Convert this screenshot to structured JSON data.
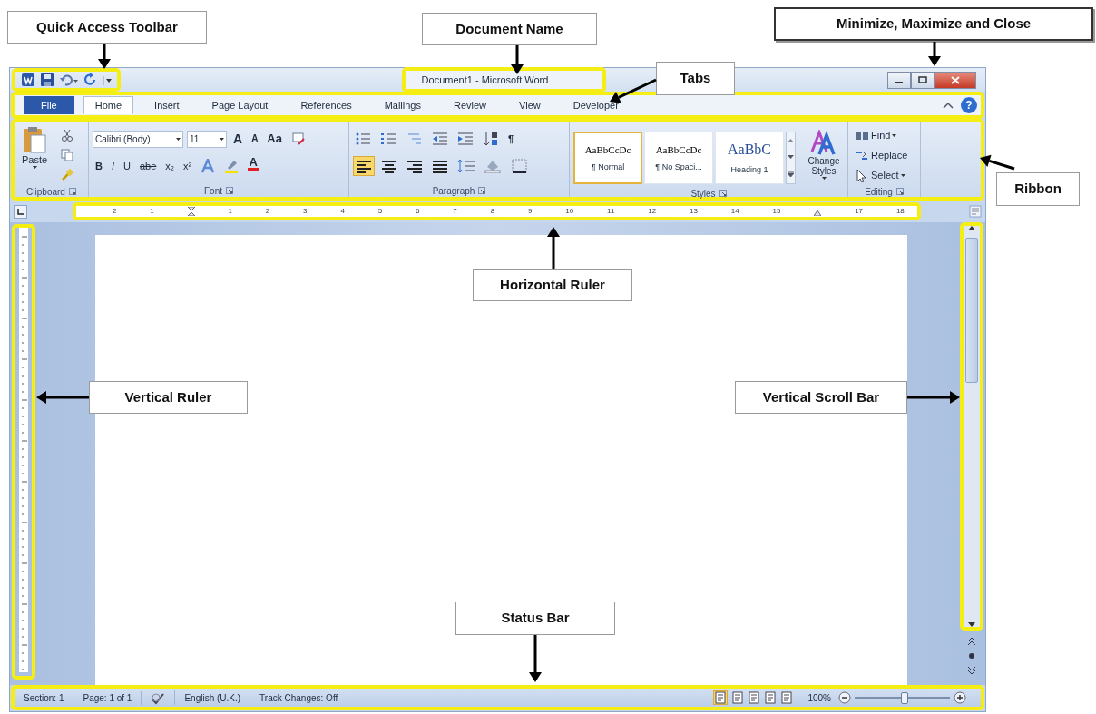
{
  "annotations": [
    {
      "text": "Quick Access Toolbar"
    },
    {
      "text": "Document Name"
    },
    {
      "text": "Minimize, Maximize and Close"
    },
    {
      "text": "Tabs"
    },
    {
      "text": "Ribbon"
    },
    {
      "text": "Horizontal Ruler"
    },
    {
      "text": "Vertical Ruler"
    },
    {
      "text": "Vertical Scroll Bar"
    },
    {
      "text": "Status Bar"
    }
  ],
  "window": {
    "title": "Document1 - Microsoft Word"
  },
  "tabs": [
    {
      "label": "File",
      "kind": "file",
      "selected": false
    },
    {
      "label": "Home",
      "kind": "tab",
      "selected": true
    },
    {
      "label": "Insert",
      "kind": "tab",
      "selected": false
    },
    {
      "label": "Page Layout",
      "kind": "tab",
      "selected": false
    },
    {
      "label": "References",
      "kind": "tab",
      "selected": false
    },
    {
      "label": "Mailings",
      "kind": "tab",
      "selected": false
    },
    {
      "label": "Review",
      "kind": "tab",
      "selected": false
    },
    {
      "label": "View",
      "kind": "tab",
      "selected": false
    },
    {
      "label": "Developer",
      "kind": "tab",
      "selected": false
    }
  ],
  "help_button": "?",
  "ribbon": {
    "clipboard": {
      "label": "Clipboard",
      "paste": "Paste"
    },
    "font": {
      "label": "Font",
      "name": "Calibri (Body)",
      "size": "11",
      "grow": "A",
      "shrink": "A",
      "change_case": "Aa",
      "buttons": [
        "B",
        "I",
        "U",
        "abe",
        "x₂",
        "x²"
      ],
      "color_button": "A"
    },
    "paragraph": {
      "label": "Paragraph",
      "marks_button": "¶",
      "alignment": [
        {
          "selected": true
        },
        {
          "selected": false
        },
        {
          "selected": false
        },
        {
          "selected": false
        }
      ]
    },
    "styles": {
      "label": "Styles",
      "items": [
        {
          "preview": "AaBbCcDc",
          "name": "¶ Normal",
          "selected": true
        },
        {
          "preview": "AaBbCcDc",
          "name": "¶ No Spaci...",
          "selected": false
        },
        {
          "preview": "AaBbC",
          "name": "Heading 1",
          "selected": false
        }
      ],
      "change_styles": "Change Styles"
    },
    "editing": {
      "label": "Editing",
      "items": [
        "Find",
        "Replace",
        "Select"
      ]
    }
  },
  "ruler": {
    "labels": [
      "2",
      "1",
      "1",
      "2",
      "3",
      "4",
      "5",
      "6",
      "7",
      "8",
      "9",
      "10",
      "11",
      "12",
      "13",
      "14",
      "15",
      "17",
      "18"
    ]
  },
  "status_bar": {
    "items": [
      "Section: 1",
      "Page: 1 of 1",
      "English (U.K.)",
      "Track Changes: Off"
    ],
    "zoom": "100%",
    "level": 0.52
  }
}
